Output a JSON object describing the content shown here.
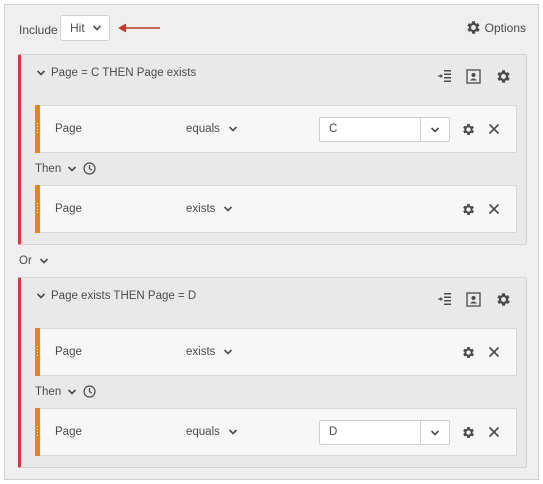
{
  "include": {
    "label": "Include",
    "value": "Hit"
  },
  "options": {
    "label": "Options"
  },
  "or_label": "Or",
  "containers": [
    {
      "title": "Page = C THEN Page exists",
      "rules": [
        {
          "dimension": "Page",
          "operator": "equals",
          "value": "C"
        },
        {
          "dimension": "Page",
          "operator": "exists"
        }
      ],
      "then_label": "Then"
    },
    {
      "title": "Page exists THEN Page = D",
      "rules": [
        {
          "dimension": "Page",
          "operator": "exists"
        },
        {
          "dimension": "Page",
          "operator": "equals",
          "value": "D"
        }
      ],
      "then_label": "Then"
    }
  ],
  "colors": {
    "container_bar": "#d7373f",
    "rule_grip": "#e68619",
    "annotation_arrow": "#c0392b"
  }
}
